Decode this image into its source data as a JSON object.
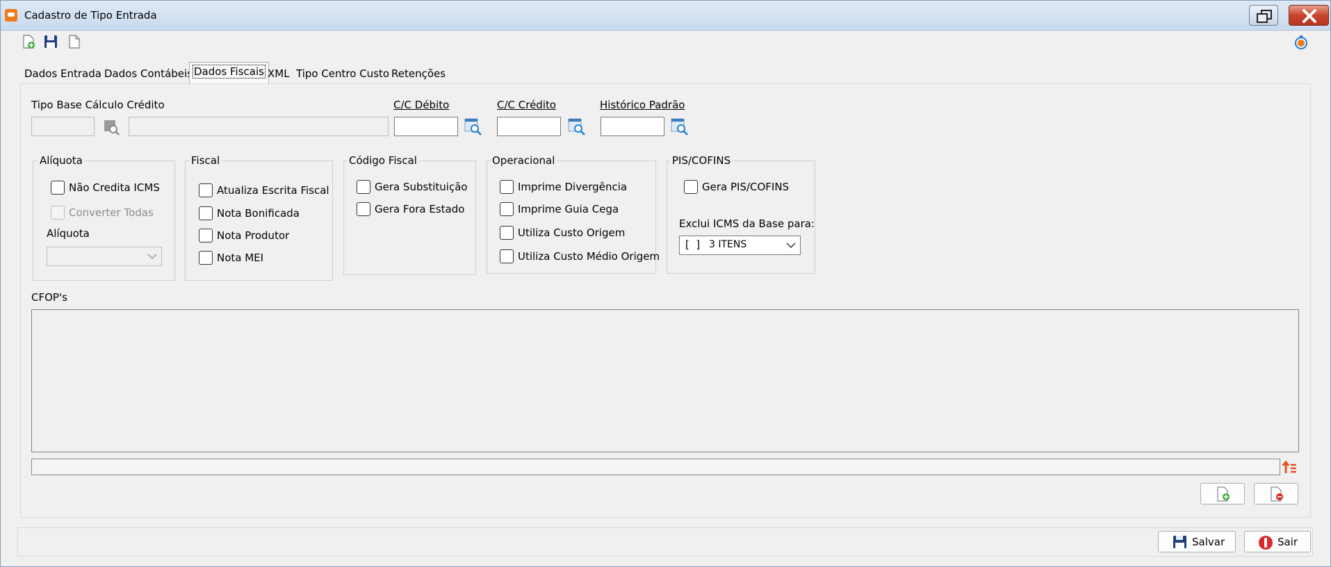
{
  "window": {
    "title": "Cadastro de Tipo Entrada"
  },
  "tabs": [
    {
      "label": "Dados Entrada"
    },
    {
      "label": "Dados Contábeis"
    },
    {
      "label": "Dados Fiscais"
    },
    {
      "label": "XML"
    },
    {
      "label": "Tipo Centro Custo"
    },
    {
      "label": "Retenções"
    }
  ],
  "fields": {
    "tipo_base_label": "Tipo Base Cálculo Crédito",
    "cc_debito_label": "C/C Débito",
    "cc_credito_label": "C/C Crédito",
    "historico_label": "Histórico Padrão"
  },
  "groups": {
    "aliquota": {
      "title": "Alíquota",
      "nao_credita": "Não Credita ICMS",
      "converter_todas": "Converter Todas",
      "aliquota_label": "Alíquota"
    },
    "fiscal": {
      "title": "Fiscal",
      "items": [
        "Atualiza Escrita Fiscal",
        "Nota Bonificada",
        "Nota Produtor",
        "Nota MEI"
      ]
    },
    "codigo_fiscal": {
      "title": "Código Fiscal",
      "items": [
        "Gera Substituição",
        "Gera Fora Estado"
      ]
    },
    "operacional": {
      "title": "Operacional",
      "items": [
        "Imprime Divergência",
        "Imprime Guia Cega",
        "Utiliza Custo Origem",
        "Utiliza Custo Médio Origem"
      ]
    },
    "pis_cofins": {
      "title": "PIS/COFINS",
      "gera": "Gera PIS/COFINS",
      "exclui_label": "Exclui ICMS da Base para:",
      "exclui_value": "3 ITENS"
    }
  },
  "cfops": {
    "label": "CFOP's"
  },
  "footer": {
    "save_label": "Salvar",
    "exit_label": "Sair"
  },
  "icons": {
    "app": "app-icon",
    "new": "new-document-icon",
    "save": "floppy-disk-icon",
    "copy": "copy-document-icon",
    "refresh": "refresh-timer-icon",
    "lookup": "lookup-search-icon",
    "sort": "sort-up-icon",
    "add": "add-item-icon",
    "remove": "remove-item-icon",
    "exit": "exit-icon"
  },
  "colors": {
    "accent_orange": "#f07a1a",
    "close_red": "#c7452d",
    "lookup_blue": "#1f7fd0"
  }
}
